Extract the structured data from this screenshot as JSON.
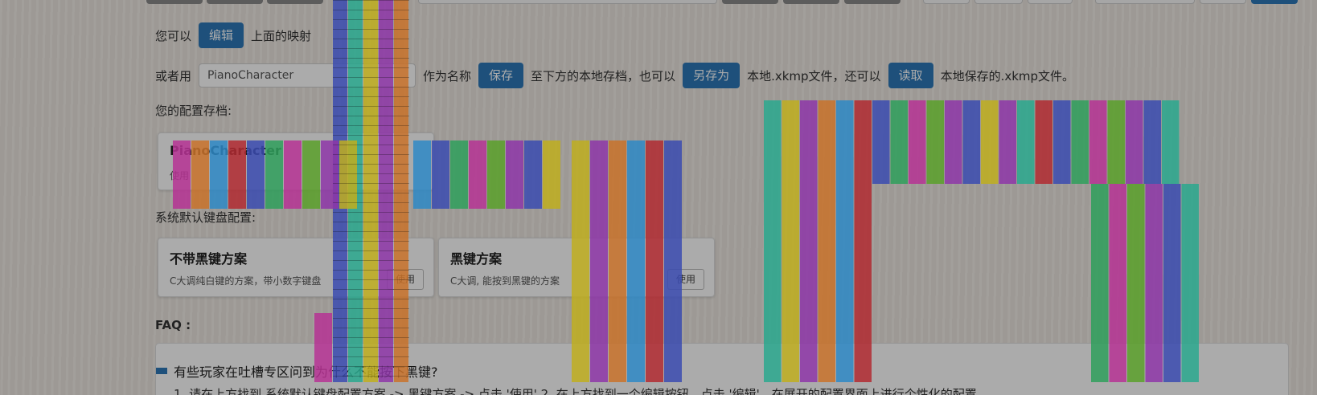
{
  "line1": {
    "prefix": "您可以",
    "edit_label": "编辑",
    "suffix": "上面的映射"
  },
  "line2": {
    "prefix": "或者用",
    "name_value": "PianoCharacter",
    "mid1": "作为名称",
    "save_label": "保存",
    "mid2": "至下方的本地存档，也可以",
    "saveas_label": "另存为",
    "mid3": "本地.xkmp文件，还可以",
    "load_label": "读取",
    "suffix": "本地保存的.xkmp文件。"
  },
  "saved_title": "您的配置存档:",
  "saved_card": {
    "title": "PianoCharacter",
    "desc": "使用"
  },
  "default_title": "系统默认键盘配置:",
  "default_cards": [
    {
      "title": "不带黑键方案",
      "desc": "C大调纯白键的方案，带小数字键盘",
      "button": "使用"
    },
    {
      "title": "黑键方案",
      "desc": "C大调, 能按到黑键的方案",
      "button": "使用"
    }
  ],
  "faq_title": "FAQ :",
  "faq_question": "有些玩家在吐槽专区问到为什么不能按下黑键?",
  "faq_answer": "1. 请在上方找到 系统默认键盘配置方案 -> 黑键方案 -> 点击 '使用'   2. 在上方找到一个编辑按钮，点击 '编辑'，在展开的配置界面上进行个性化的配置",
  "colors": {
    "accent": "#2e78b8",
    "key_palette": [
      "#3b4bb0",
      "#2aa88e",
      "#bfae1e",
      "#8e36a8",
      "#c9722a",
      "#b12a31",
      "#2e88c5",
      "#2f9f5c",
      "#b63394",
      "#5aa02a"
    ]
  }
}
